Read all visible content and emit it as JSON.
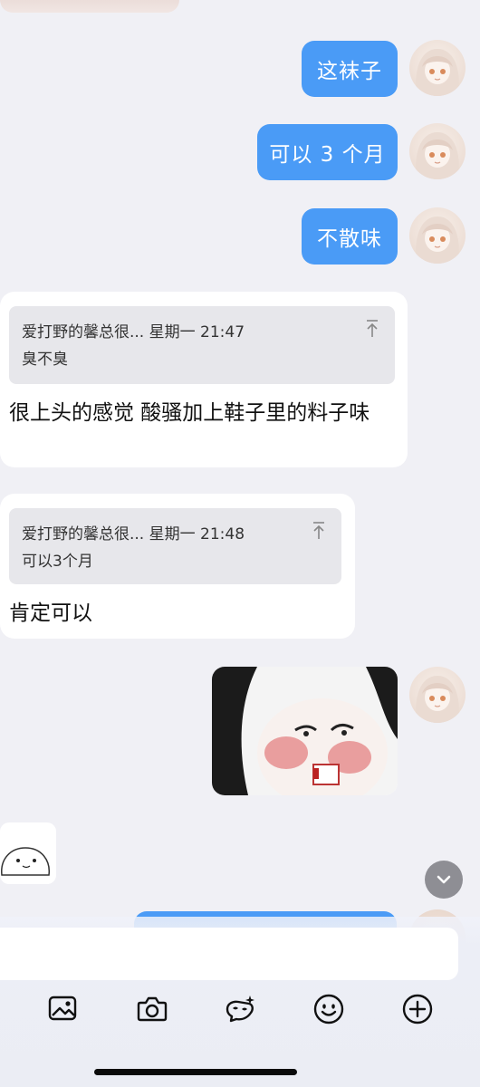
{
  "messages": {
    "out1": "这袜子",
    "out2": "可以 3 个月",
    "out3": "不散味",
    "quote1_meta": "爱打野的馨总很... 星期一 21:47",
    "quote1_text": "臭不臭",
    "reply1": "很上头的感觉 酸骚加上鞋子里的料子味",
    "quote2_meta": "爱打野的馨总很... 星期一 21:48",
    "quote2_text": "可以3个月",
    "reply2": "肯定可以"
  },
  "colors": {
    "background": "#f0f0f5",
    "outgoing_bubble": "#4a9bf6",
    "incoming_bubble": "#ffffff",
    "quote_background": "#e7e7eb"
  },
  "toolbar": {
    "icons": [
      "image-icon",
      "camera-icon",
      "face-magic-icon",
      "smiley-icon",
      "plus-circle-icon"
    ]
  },
  "input": {
    "placeholder": ""
  }
}
